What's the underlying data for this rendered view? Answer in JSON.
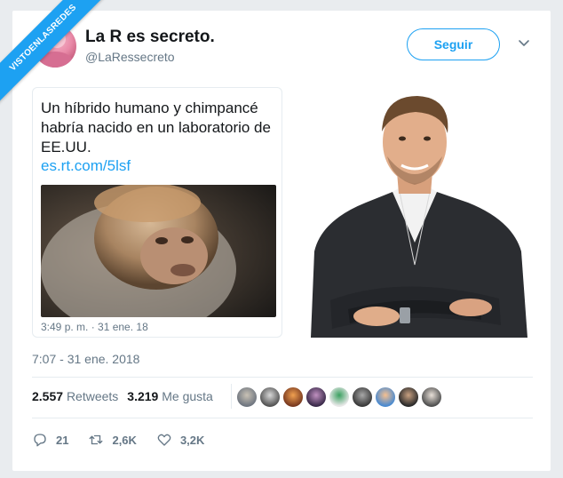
{
  "watermark": "VISTOENLASREDES",
  "tweet": {
    "display_name": "La R es secreto.",
    "handle": "@LaRessecreto",
    "follow_label": "Seguir",
    "timestamp": "7:07 - 31 ene. 2018"
  },
  "quoted_tweet": {
    "text": "Un híbrido humano y chimpancé habría nacido en un laboratorio de EE.UU.",
    "link": "es.rt.com/5lsf",
    "time": "3:49 p. m. · 31 ene. 18"
  },
  "stats": {
    "retweets_count": "2.557",
    "retweets_label": "Retweets",
    "likes_count": "3.219",
    "likes_label": "Me gusta"
  },
  "actions": {
    "reply_count": "21",
    "retweet_count": "2,6K",
    "like_count": "3,2K"
  },
  "colors": {
    "accent": "#1da1f2",
    "secondary_text": "#657786",
    "primary_text": "#14171a"
  },
  "icons": [
    "caret-down-icon",
    "reply-icon",
    "retweet-icon",
    "heart-icon"
  ]
}
